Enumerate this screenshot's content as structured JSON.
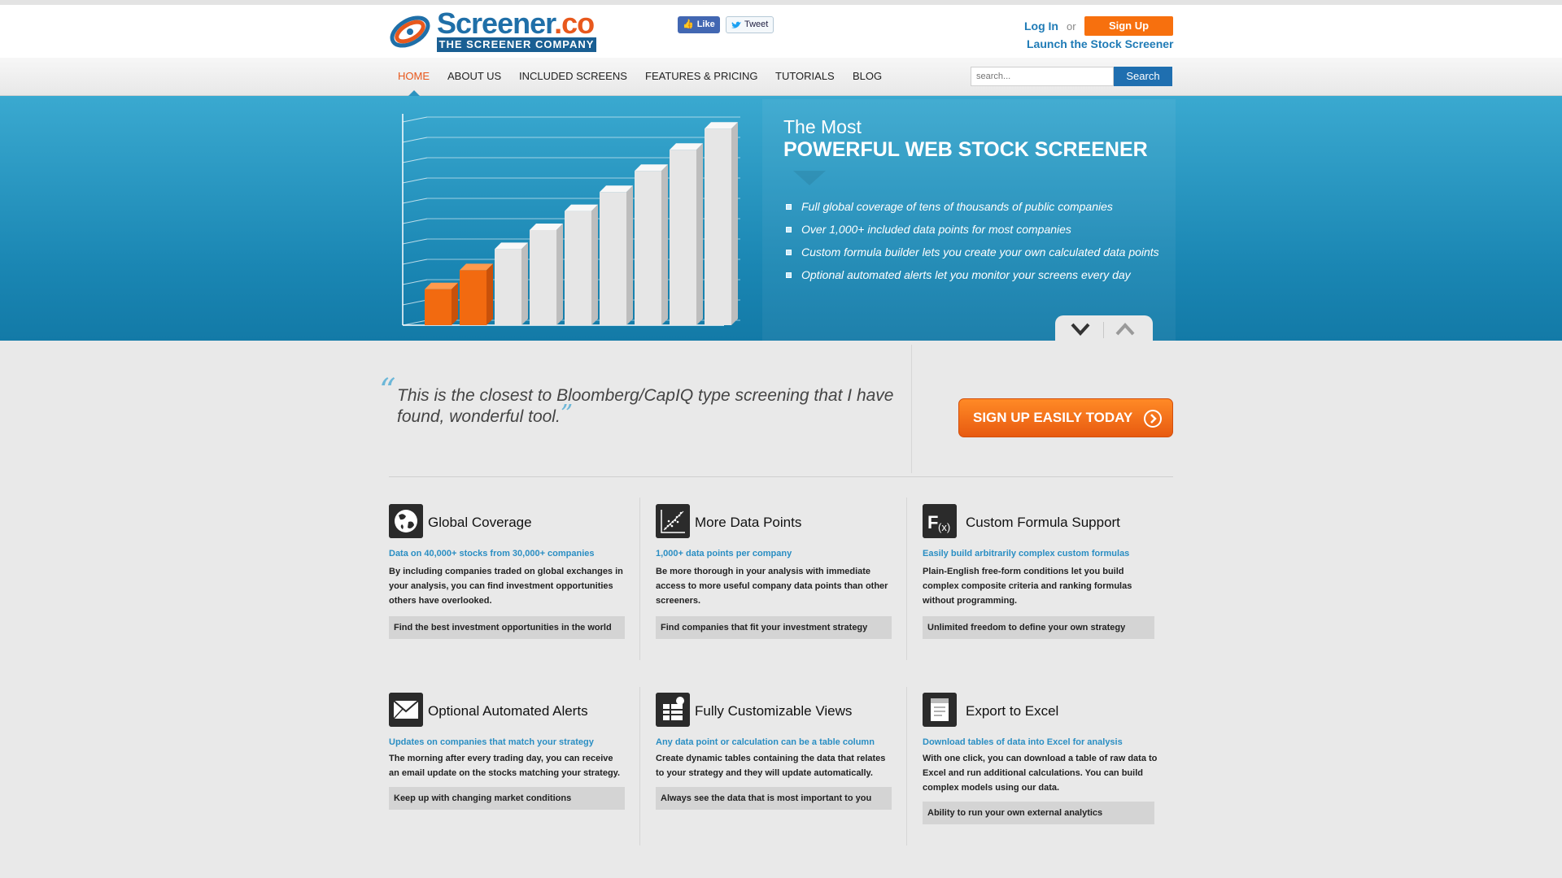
{
  "header": {
    "logo_main": "Screener",
    "logo_tld": ".co",
    "logo_subtitle": "THE SCREENER COMPANY",
    "fb_like": "Like",
    "tweet": "Tweet",
    "login": "Log In",
    "or": "or",
    "signup": "Sign Up",
    "launch": "Launch the Stock Screener"
  },
  "nav": {
    "items": [
      "HOME",
      "ABOUT US",
      "INCLUDED SCREENS",
      "FEATURES & PRICING",
      "TUTORIALS",
      "BLOG"
    ],
    "active": "HOME",
    "search_placeholder": "search...",
    "search_button": "Search"
  },
  "hero": {
    "title_line1": "The Most",
    "title_line2": "POWERFUL WEB STOCK SCREENER",
    "bullets": [
      "Full global coverage of tens of thousands of public companies",
      "Over 1,000+ included data points for most companies",
      "Custom formula builder lets you create your own calculated data points",
      "Optional automated alerts let you monitor your screens every day"
    ],
    "chart_bar_levels": [
      0.17,
      0.26,
      0.36,
      0.45,
      0.54,
      0.63,
      0.73,
      0.83,
      0.93
    ],
    "chart_highlight_count": 2,
    "colors": {
      "highlight": "#f26a10",
      "bar": "#e6e6e6"
    }
  },
  "testimonial": {
    "quote": "This is the closest to Bloomberg/CapIQ type screening that I have found, wonderful tool.",
    "cta": "SIGN UP EASILY TODAY"
  },
  "features": [
    {
      "title": "Global Coverage",
      "icon": "globe-icon",
      "subtitle": "Data on 40,000+ stocks from 30,000+ companies",
      "description": "By including companies traded on global exchanges in your analysis, you can find investment opportunities others have overlooked.",
      "box": "Find the best investment opportunities in the world"
    },
    {
      "title": "More Data Points",
      "icon": "scatter-chart-icon",
      "subtitle": "1,000+ data points per company",
      "description": "Be more thorough in your analysis with immediate access to more useful company data points than other screeners.",
      "box": "Find companies that fit your investment strategy"
    },
    {
      "title": "Custom Formula Support",
      "icon": "formula-icon",
      "subtitle": "Easily build arbitrarily complex custom formulas",
      "description": "Plain-English free-form conditions let you build complex composite criteria and ranking formulas without programming.",
      "box": "Unlimited freedom to define your own strategy"
    },
    {
      "title": "Optional Automated Alerts",
      "icon": "envelope-icon",
      "subtitle": "Updates on companies that match your strategy",
      "description": "The morning after every trading day, you can receive an email update on the stocks matching your strategy.",
      "box": "Keep up with changing market conditions"
    },
    {
      "title": "Fully Customizable Views",
      "icon": "table-view-icon",
      "subtitle": "Any data point or calculation can be a table column",
      "description": "Create dynamic tables containing the data that relates to your strategy and they will update automatically.",
      "box": "Always see the data that is most important to you"
    },
    {
      "title": "Export to Excel",
      "icon": "excel-export-icon",
      "subtitle": "Download tables of data into Excel for analysis",
      "description": "With one click, you can download a table of raw data to Excel and run additional calculations. You can build complex models using our data.",
      "box": "Ability to run your own external analytics"
    }
  ]
}
